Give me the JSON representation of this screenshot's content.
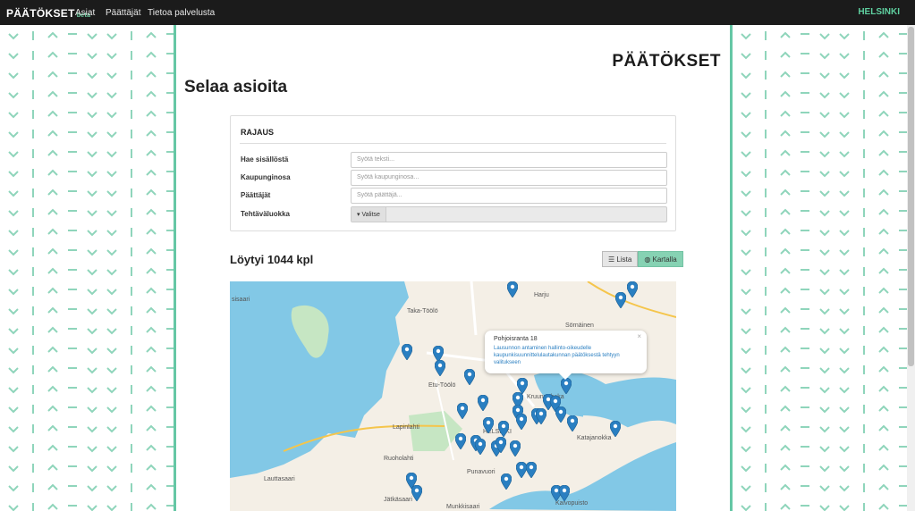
{
  "header": {
    "brand": "PÄÄTÖKSET",
    "beta": "beta",
    "nav": [
      "Asiat",
      "Päättäjät",
      "Tietoa palvelusta"
    ],
    "city": "HELSINKI"
  },
  "logo": "PÄÄTÖKSET",
  "page_title": "Selaa asioita",
  "filter": {
    "title": "RAJAUS",
    "content_label": "Hae sisällöstä",
    "content_placeholder": "Syötä teksti...",
    "district_label": "Kaupunginosa",
    "district_placeholder": "Syötä kaupunginosa...",
    "decider_label": "Päättäjät",
    "decider_placeholder": "Syötä päättäjä...",
    "category_label": "Tehtäväluokka",
    "category_button": "▾ Valitse"
  },
  "results": {
    "count_text": "Löytyi 1044 kpl",
    "view_list": "Lista",
    "view_map": "Kartalla",
    "active_view": "Kartalla"
  },
  "map": {
    "labels": [
      "Harju",
      "Sörnäinen",
      "Taka-Töölö",
      "Etu-Töölö",
      "Kruununhaka",
      "HELSINKI",
      "Katajanokka",
      "Lapinlahti",
      "Ruoholahti",
      "Punavuori",
      "Lauttasaari",
      "Jätkäsaari",
      "Munkkisaari",
      "Kaivopuisto",
      "sisaari"
    ],
    "popup": {
      "title": "Pohjoisranta 18",
      "description": "Lausunnon antaminen hallinto-oikeudelle kaupunkisuunnittelulautakunnan päätöksestä tehtyyn valitukseen",
      "close": "×"
    }
  },
  "colors": {
    "accent": "#65c7a5",
    "pin": "#2a7fc1",
    "water": "#82c8e6",
    "park": "#c6e6c3"
  }
}
